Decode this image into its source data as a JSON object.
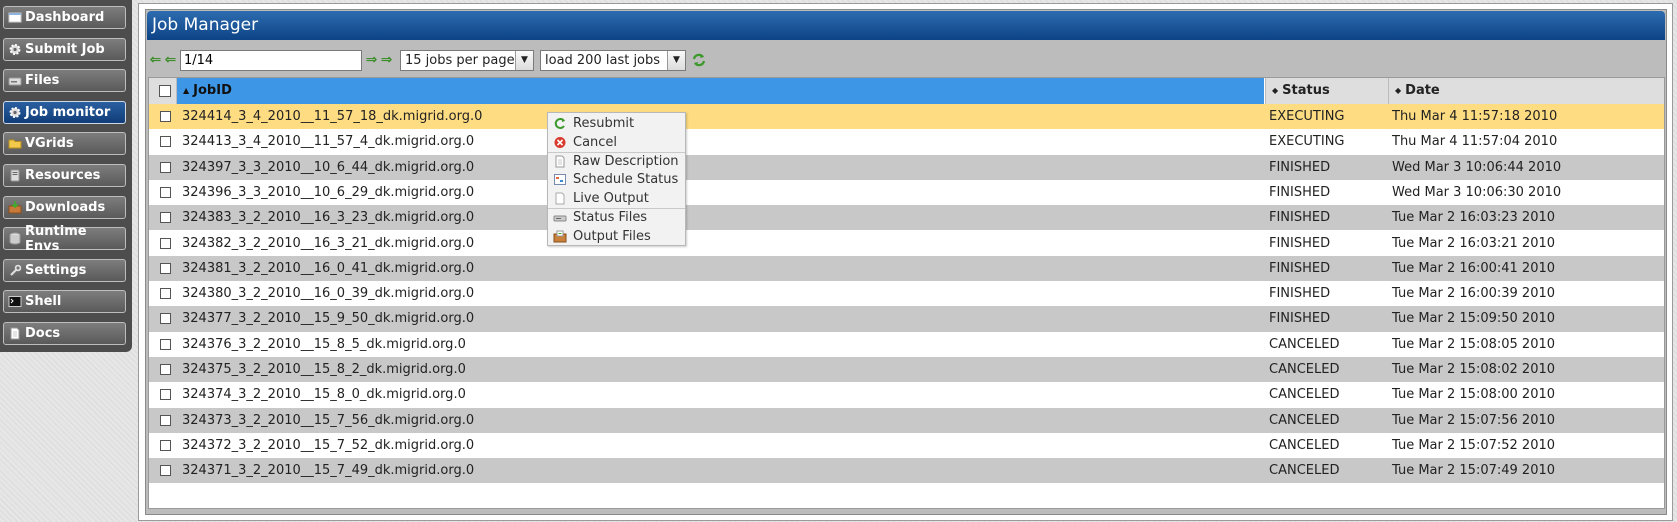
{
  "nav": {
    "items": [
      {
        "label": "Dashboard",
        "icon": "dashboard-icon"
      },
      {
        "label": "Submit Job",
        "icon": "gear-icon"
      },
      {
        "label": "Files",
        "icon": "folder-drive-icon"
      },
      {
        "label": "Job monitor",
        "icon": "gear-icon",
        "active": true
      },
      {
        "label": "VGrids",
        "icon": "folder-icon"
      },
      {
        "label": "Resources",
        "icon": "server-icon"
      },
      {
        "label": "Downloads",
        "icon": "download-box-icon"
      },
      {
        "label": "Runtime Envs",
        "icon": "database-icon"
      },
      {
        "label": "Settings",
        "icon": "wrench-icon"
      },
      {
        "label": "Shell",
        "icon": "terminal-icon"
      },
      {
        "label": "Docs",
        "icon": "document-icon"
      }
    ]
  },
  "title": "Job Manager",
  "pager": {
    "page": "1/14",
    "per_page": "15 jobs per page",
    "load": "load 200 last jobs"
  },
  "table": {
    "headers": {
      "jobid": "JobID",
      "status": "Status",
      "date": "Date"
    },
    "rows": [
      {
        "id": "324414_3_4_2010__11_57_18_dk.migrid.org.0",
        "status": "EXECUTING",
        "date": "Thu Mar 4 11:57:18 2010",
        "selected": true
      },
      {
        "id": "324413_3_4_2010__11_57_4_dk.migrid.org.0",
        "status": "EXECUTING",
        "date": "Thu Mar 4 11:57:04 2010"
      },
      {
        "id": "324397_3_3_2010__10_6_44_dk.migrid.org.0",
        "status": "FINISHED",
        "date": "Wed Mar 3 10:06:44 2010"
      },
      {
        "id": "324396_3_3_2010__10_6_29_dk.migrid.org.0",
        "status": "FINISHED",
        "date": "Wed Mar 3 10:06:30 2010"
      },
      {
        "id": "324383_3_2_2010__16_3_23_dk.migrid.org.0",
        "status": "FINISHED",
        "date": "Tue Mar 2 16:03:23 2010"
      },
      {
        "id": "324382_3_2_2010__16_3_21_dk.migrid.org.0",
        "status": "FINISHED",
        "date": "Tue Mar 2 16:03:21 2010"
      },
      {
        "id": "324381_3_2_2010__16_0_41_dk.migrid.org.0",
        "status": "FINISHED",
        "date": "Tue Mar 2 16:00:41 2010"
      },
      {
        "id": "324380_3_2_2010__16_0_39_dk.migrid.org.0",
        "status": "FINISHED",
        "date": "Tue Mar 2 16:00:39 2010"
      },
      {
        "id": "324377_3_2_2010__15_9_50_dk.migrid.org.0",
        "status": "FINISHED",
        "date": "Tue Mar 2 15:09:50 2010"
      },
      {
        "id": "324376_3_2_2010__15_8_5_dk.migrid.org.0",
        "status": "CANCELED",
        "date": "Tue Mar 2 15:08:05 2010"
      },
      {
        "id": "324375_3_2_2010__15_8_2_dk.migrid.org.0",
        "status": "CANCELED",
        "date": "Tue Mar 2 15:08:02 2010"
      },
      {
        "id": "324374_3_2_2010__15_8_0_dk.migrid.org.0",
        "status": "CANCELED",
        "date": "Tue Mar 2 15:08:00 2010"
      },
      {
        "id": "324373_3_2_2010__15_7_56_dk.migrid.org.0",
        "status": "CANCELED",
        "date": "Tue Mar 2 15:07:56 2010"
      },
      {
        "id": "324372_3_2_2010__15_7_52_dk.migrid.org.0",
        "status": "CANCELED",
        "date": "Tue Mar 2 15:07:52 2010"
      },
      {
        "id": "324371_3_2_2010__15_7_49_dk.migrid.org.0",
        "status": "CANCELED",
        "date": "Tue Mar 2 15:07:49 2010"
      }
    ]
  },
  "context_menu": {
    "items": [
      {
        "label": "Resubmit",
        "icon": "resubmit-icon"
      },
      {
        "label": "Cancel",
        "icon": "cancel-icon"
      },
      {
        "label": "Raw Description",
        "icon": "document-icon",
        "separator": true
      },
      {
        "label": "Schedule Status",
        "icon": "calendar-icon"
      },
      {
        "label": "Live Output",
        "icon": "blank-page-icon"
      },
      {
        "label": "Status Files",
        "icon": "drive-icon",
        "separator": true
      },
      {
        "label": "Output Files",
        "icon": "output-box-icon"
      }
    ]
  }
}
